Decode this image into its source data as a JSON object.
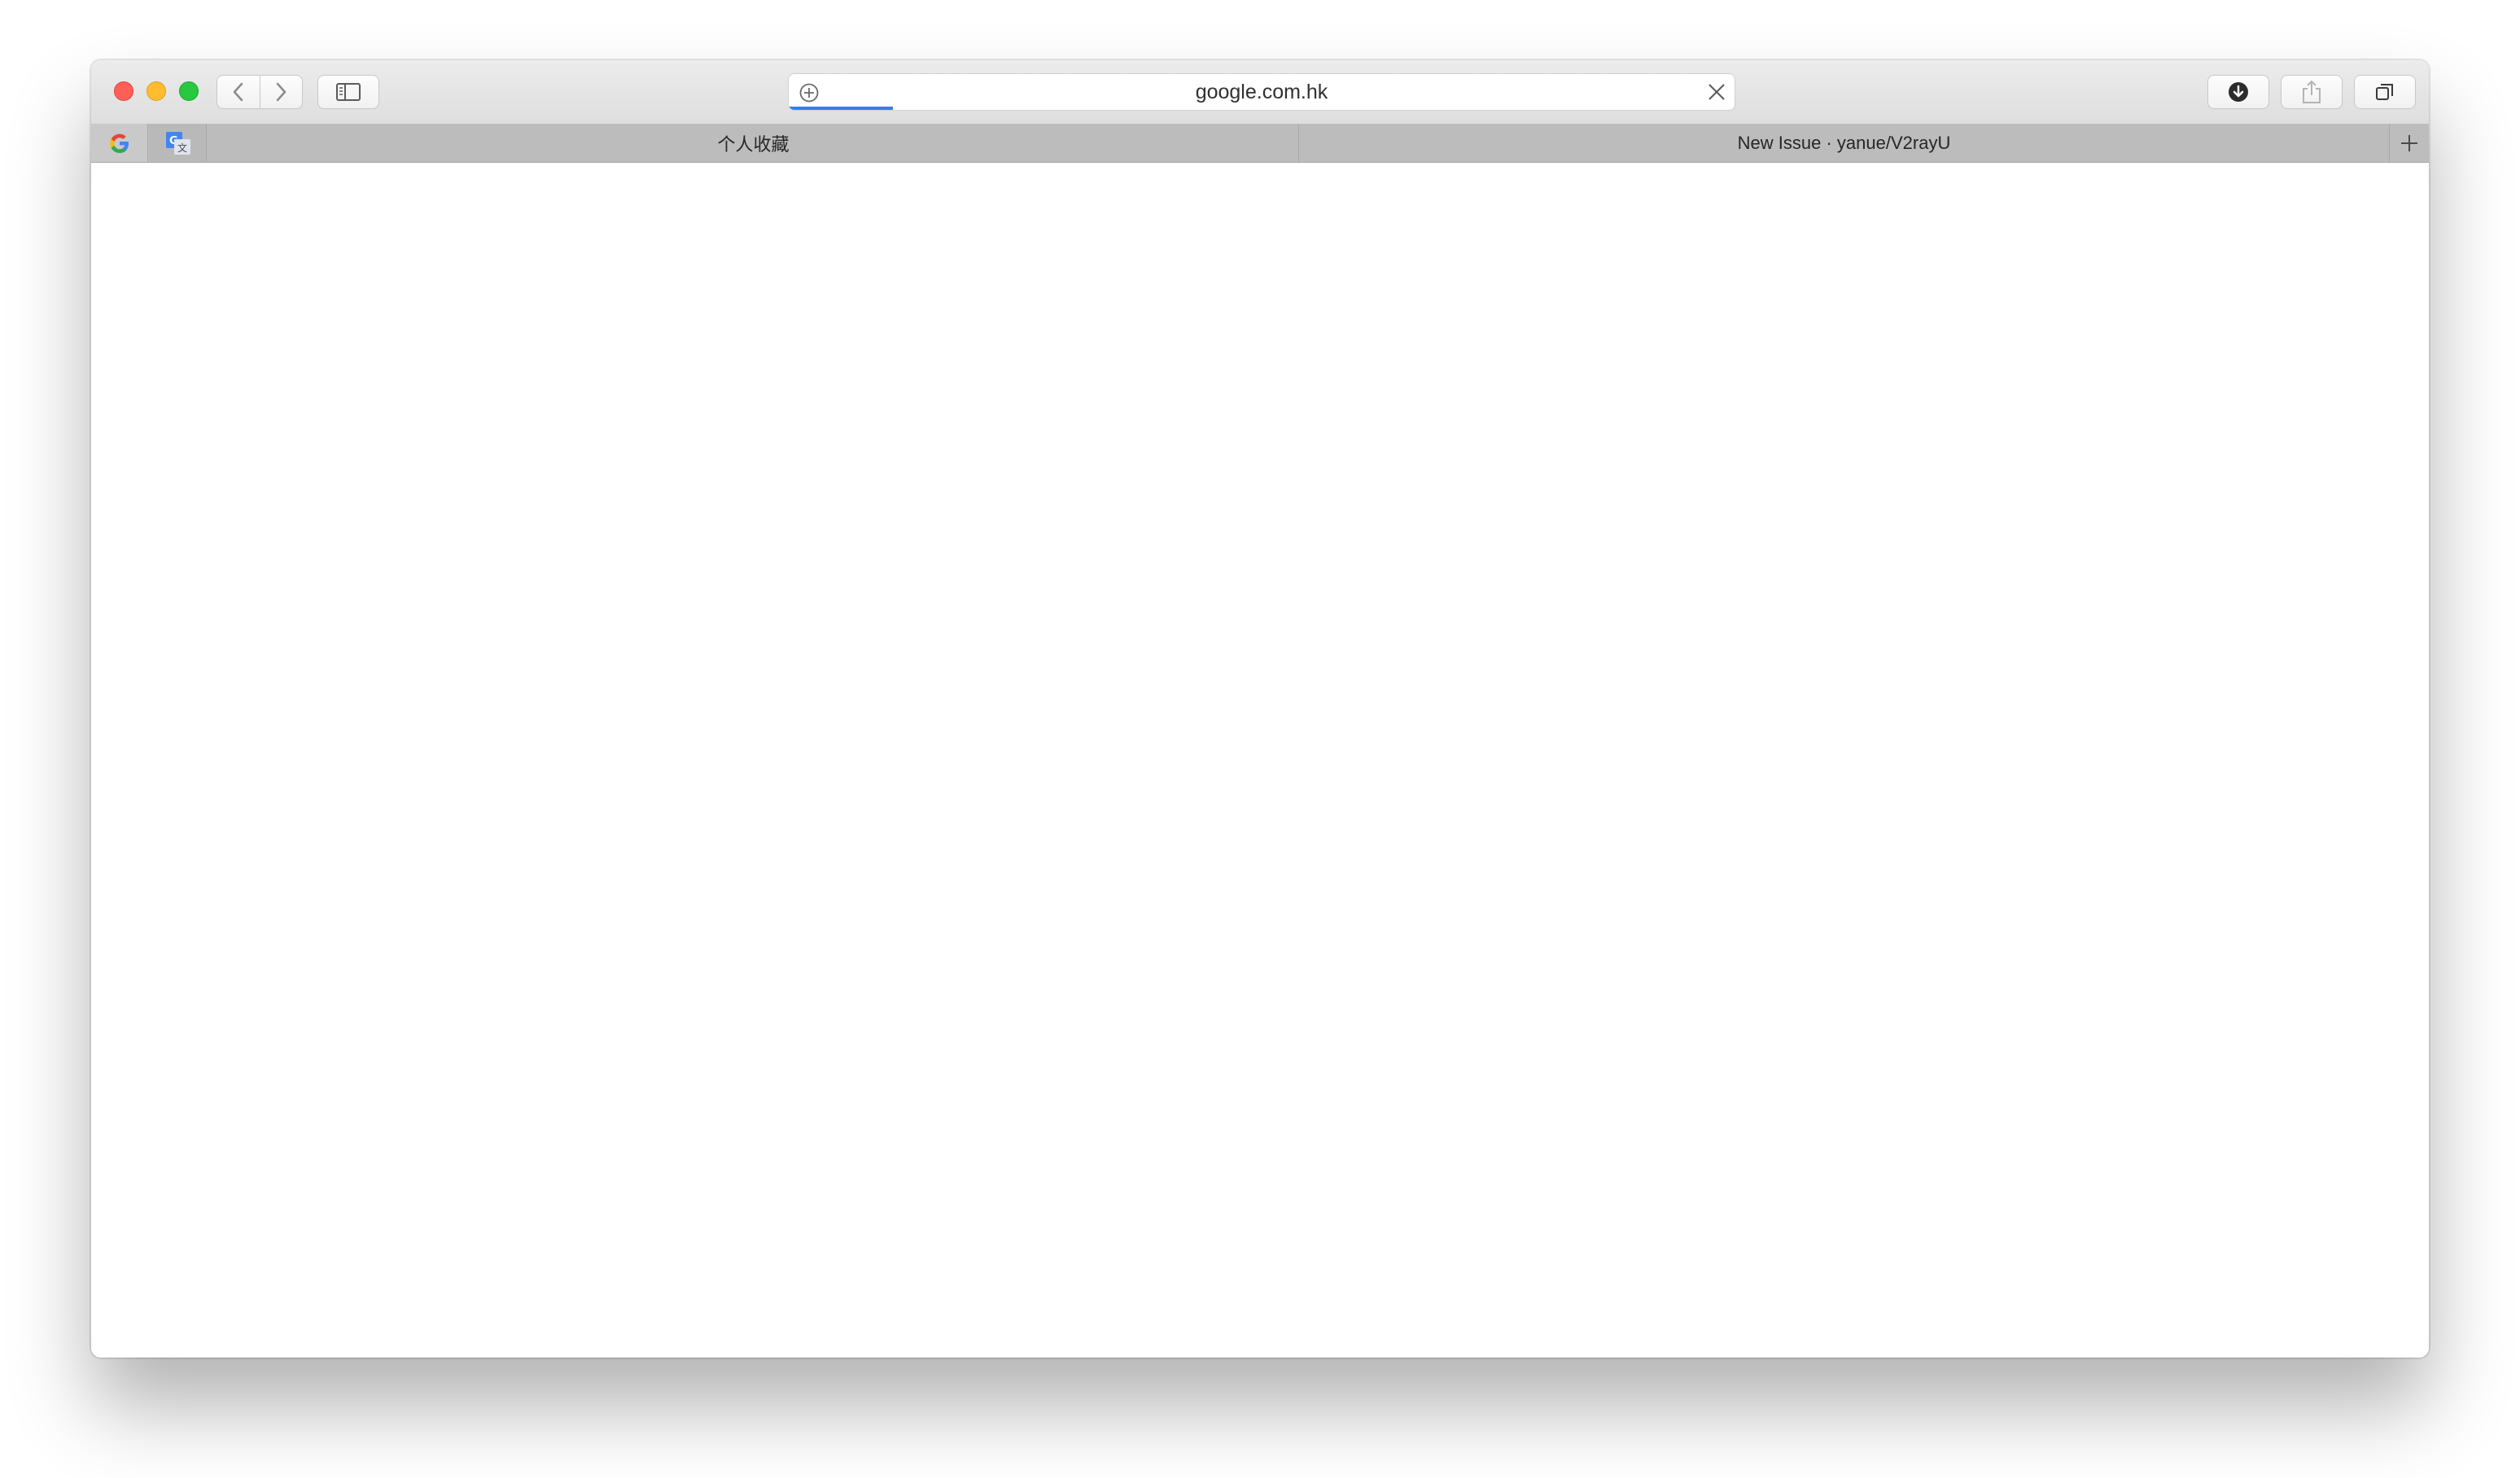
{
  "address_bar": {
    "url": "google.com.hk",
    "load_progress_percent": 11
  },
  "tabs": [
    {
      "label": "个人收藏",
      "active": false
    },
    {
      "label": "New Issue · yanue/V2rayU",
      "active": false
    }
  ],
  "pinned_tabs": [
    {
      "icon": "google-g-icon"
    },
    {
      "icon": "google-translate-icon"
    }
  ],
  "icons": {
    "back": "chevron-left-icon",
    "forward": "chevron-right-icon",
    "sidebar": "sidebar-icon",
    "downloads": "download-icon",
    "share": "share-icon",
    "tabs_overview": "tabs-overview-icon",
    "new_tab": "plus-icon",
    "stop": "close-icon"
  },
  "colors": {
    "traffic_close": "#fe5f57",
    "traffic_min": "#febc2e",
    "traffic_max": "#28c840",
    "progress": "#2f7ff1"
  }
}
